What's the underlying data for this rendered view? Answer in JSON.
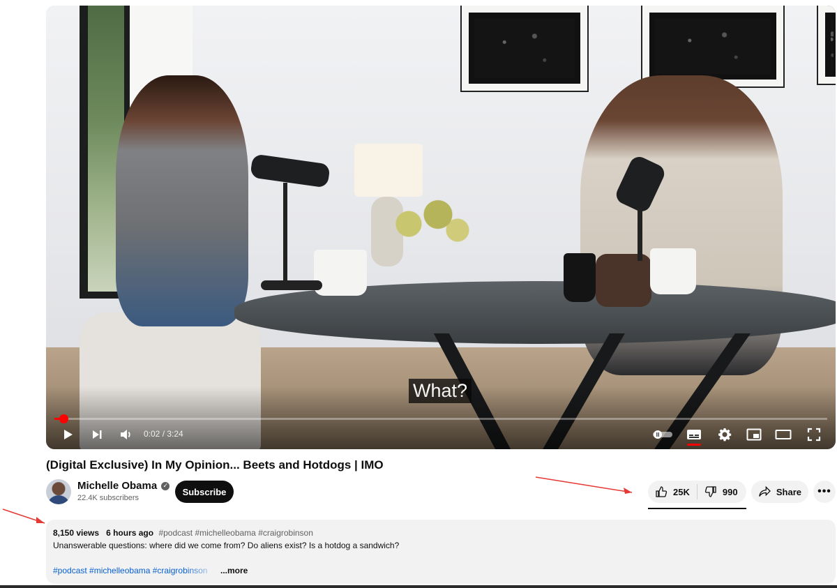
{
  "player": {
    "caption": "What?",
    "time": "0:02 / 3:24",
    "progress_fraction": 0.002
  },
  "video": {
    "title": "(Digital Exclusive) In My Opinion... Beets and Hotdogs | IMO"
  },
  "channel": {
    "name": "Michelle Obama",
    "subscribers": "22.4K subscribers",
    "subscribe_label": "Subscribe"
  },
  "actions": {
    "likes": "25K",
    "dislikes": "990",
    "share_label": "Share",
    "more_label": "•••"
  },
  "description": {
    "views": "8,150 views",
    "age": "6 hours ago",
    "meta_tags": "#podcast #michelleobama #craigrobinson",
    "text": "Unanswerable questions: where did we come from? Do aliens exist? Is a hotdog a sandwich?",
    "tags": "#podcast #michelleobama #craigrobinson",
    "more_label": "...more"
  },
  "colors": {
    "accent_red": "#ff0000",
    "link_blue": "#065fd4",
    "annotation_arrow": "#e53935"
  }
}
